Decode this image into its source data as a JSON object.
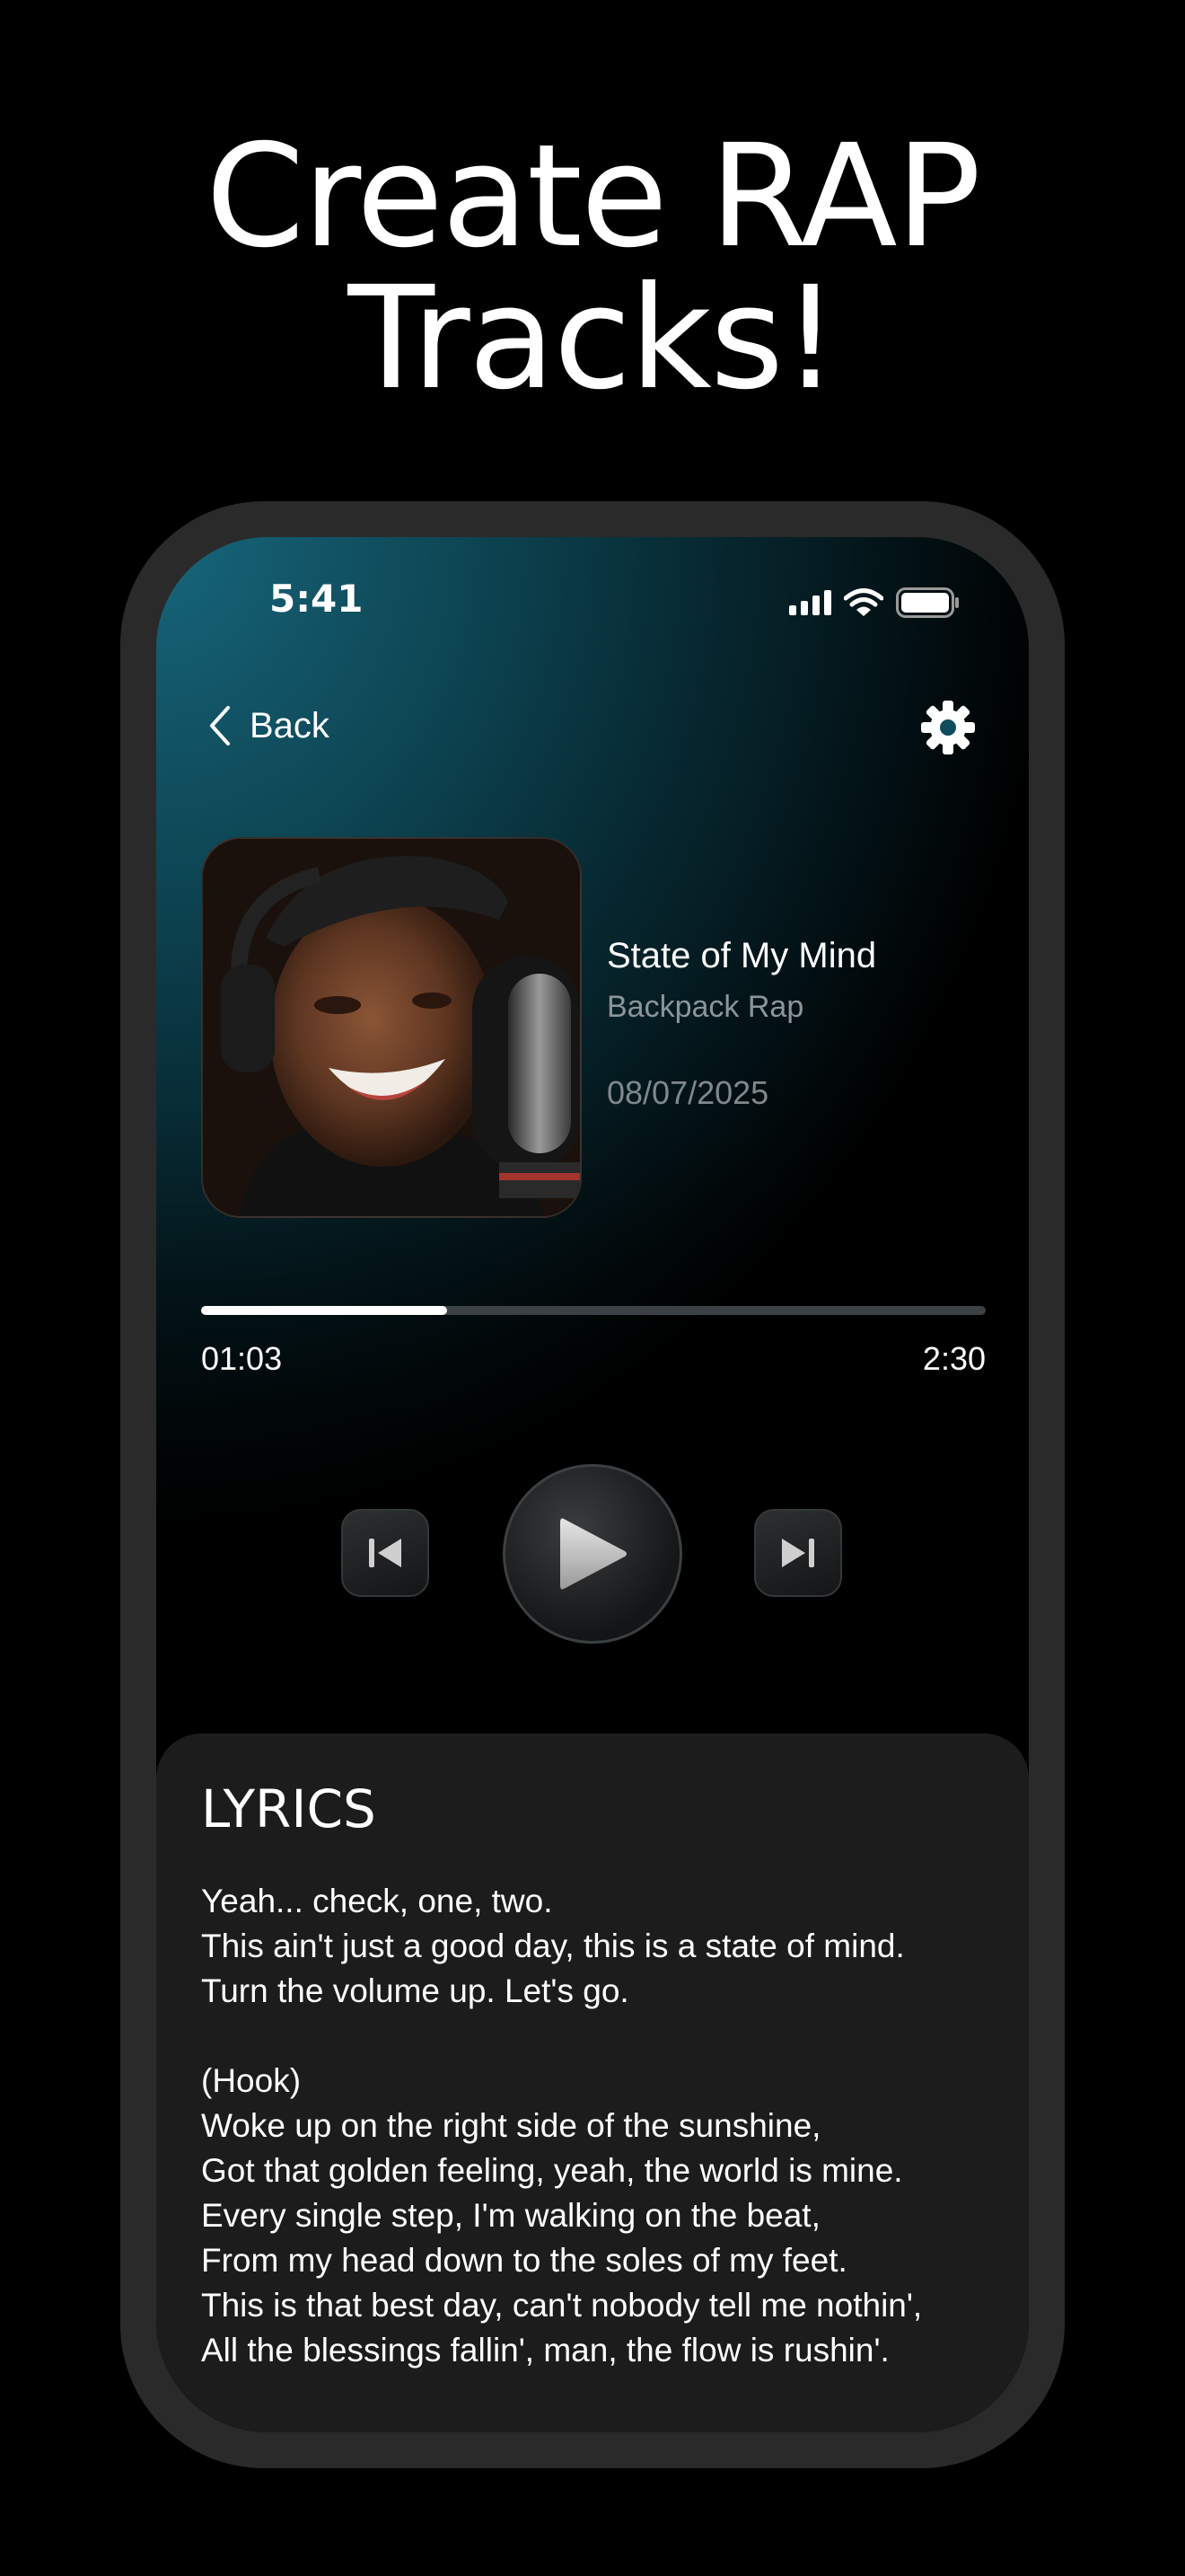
{
  "headline": {
    "line1": "Create RAP",
    "line2": "Tracks!"
  },
  "status_bar": {
    "time": "5:41",
    "icons": [
      "cellular-signal-icon",
      "wifi-icon",
      "battery-icon"
    ]
  },
  "nav": {
    "back_label": "Back",
    "back_icon": "chevron-left-icon",
    "settings_icon": "gear-icon"
  },
  "track": {
    "title": "State of My Mind",
    "genre": "Backpack Rap",
    "date": "08/07/2025",
    "cover": "rapper-singing-into-microphone-photo"
  },
  "player": {
    "current_time": "01:03",
    "total_time": "2:30",
    "progress_fraction": 0.313,
    "controls": [
      "skip-previous-icon",
      "play-icon",
      "skip-next-icon"
    ]
  },
  "lyrics": {
    "title": "LYRICS",
    "lines": [
      "Yeah... check, one, two.",
      "This ain't just a good day, this is a state of mind.",
      "Turn the volume up. Let's go.",
      "",
      "(Hook)",
      "Woke up on the right side of the sunshine,",
      "Got that golden feeling, yeah, the world is mine.",
      "Every single step, I'm walking on the beat,",
      "From my head down to the soles of my feet.",
      "This is that best day, can't nobody tell me nothin',",
      "All the blessings fallin', man, the flow is rushin'."
    ]
  },
  "colors": {
    "accent_top": "#17667c",
    "panel": "#1c1c1d",
    "muted_text": "#8c959a"
  }
}
